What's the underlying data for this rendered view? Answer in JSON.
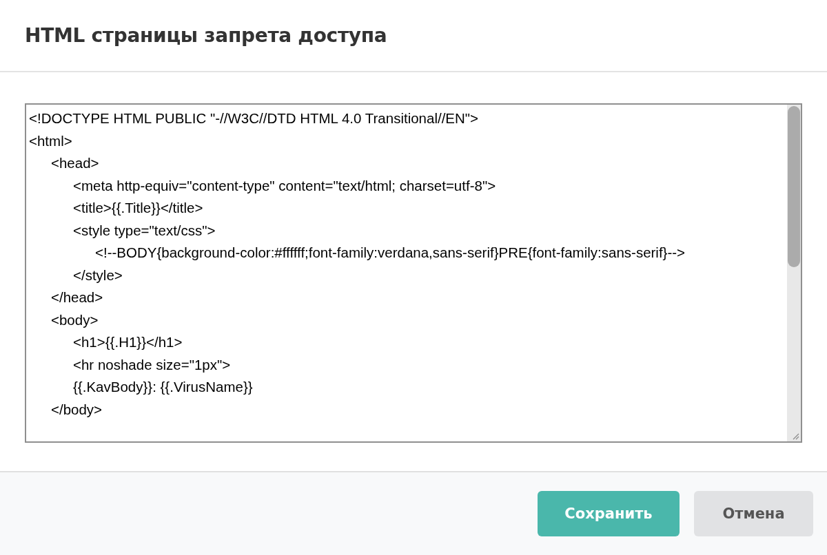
{
  "dialog": {
    "title": "HTML страницы запрета доступа",
    "editor": {
      "value": "<!DOCTYPE HTML PUBLIC \"-//W3C//DTD HTML 4.0 Transitional//EN\">\n<html>\n\t<head>\n\t\t<meta http-equiv=\"content-type\" content=\"text/html; charset=utf-8\">\n\t\t<title>{{.Title}}</title>\n\t\t<style type=\"text/css\">\n\t\t\t<!--BODY{background-color:#ffffff;font-family:verdana,sans-serif}PRE{font-family:sans-serif}-->\n\t\t</style>\n\t</head>\n\t<body>\n\t\t<h1>{{.H1}}</h1>\n\t\t<hr noshade size=\"1px\">\n\t\t{{.KavBody}}: {{.VirusName}}\n\t</body>"
    },
    "buttons": [
      {
        "label": "Сохранить",
        "kind": "primary"
      },
      {
        "label": "Отмена",
        "kind": "secondary"
      }
    ]
  }
}
